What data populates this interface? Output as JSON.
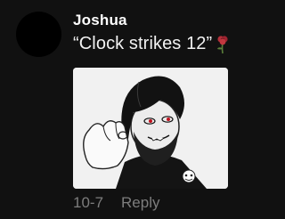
{
  "comment": {
    "username": "Joshua",
    "text": "“Clock strikes 12”",
    "emoji_icon": "rose-emoji-icon",
    "sticker": "emo-character-sticker",
    "date": "10-7",
    "reply_label": "Reply"
  },
  "colors": {
    "background": "#111111",
    "text": "#f2f2f2",
    "meta": "#7d7d7d",
    "sticker_bg": "#f1f1f1"
  }
}
